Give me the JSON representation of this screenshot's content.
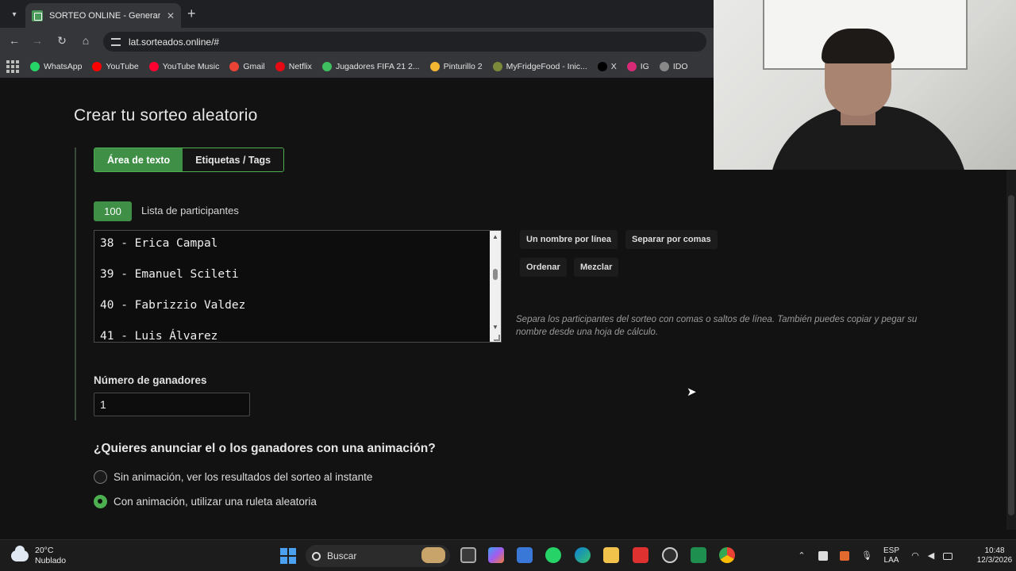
{
  "browser": {
    "tab_title": "SORTEO ONLINE - Generar un sorteo",
    "new_tab_glyph": "+",
    "close_glyph": "✕",
    "url": "lat.sorteados.online/#",
    "bookmarks": [
      {
        "label": "WhatsApp",
        "icon": "whatsapp-icon",
        "color": "#25d366"
      },
      {
        "label": "YouTube",
        "icon": "youtube-icon",
        "color": "#ff0000"
      },
      {
        "label": "YouTube Music",
        "icon": "youtube-music-icon",
        "color": "#ff0033"
      },
      {
        "label": "Gmail",
        "icon": "gmail-icon",
        "color": "#ea4335"
      },
      {
        "label": "Netflix",
        "icon": "netflix-icon",
        "color": "#e50914"
      },
      {
        "label": "Jugadores FIFA 21 2...",
        "icon": "fifa-icon",
        "color": "#3fbf5f"
      },
      {
        "label": "Pinturillo 2",
        "icon": "pinturillo-icon",
        "color": "#f2b632"
      },
      {
        "label": "MyFridgeFood - Inic...",
        "icon": "myfridgefood-icon",
        "color": "#7a8a3a"
      },
      {
        "label": "X",
        "icon": "x-icon",
        "color": "#000000"
      },
      {
        "label": "IG",
        "icon": "instagram-icon",
        "color": "#d62976"
      },
      {
        "label": "IDO",
        "icon": "ido-icon",
        "color": "#888888"
      }
    ]
  },
  "page": {
    "heading": "Crear tu sorteo aleatorio",
    "tabs": [
      {
        "label": "Área de texto",
        "active": true
      },
      {
        "label": "Etiquetas / Tags",
        "active": false
      }
    ],
    "participants_count": "100",
    "list_label": "Lista de participantes",
    "participants_visible": [
      "38 - Erica Campal",
      "39 - Emanuel Scileti",
      "40 - Fabrizzio Valdez",
      "41 - Luis Álvarez"
    ],
    "tools": {
      "one_per_line": "Un nombre por línea",
      "separate_commas": "Separar por comas",
      "sort": "Ordenar",
      "shuffle": "Mezclar"
    },
    "helper_text": "Separa los participantes del sorteo con comas o saltos de línea. También puedes copiar y pegar su nombre desde una hoja de cálculo.",
    "winners_label": "Número de ganadores",
    "winners_value": "1",
    "animation_question": "¿Quieres anunciar el o los ganadores con una animación?",
    "animation_options": [
      {
        "label": "Sin animación, ver los resultados del sorteo al instante",
        "selected": false
      },
      {
        "label": "Con animación, utilizar una ruleta aleatoria",
        "selected": true
      }
    ],
    "accent_color": "#3f8f47"
  },
  "taskbar": {
    "temperature": "20°C",
    "weather": "Nublado",
    "search_placeholder": "Buscar",
    "language_line1": "ESP",
    "language_line2": "LAA",
    "time": "10:48",
    "date": "12/3/2026"
  }
}
